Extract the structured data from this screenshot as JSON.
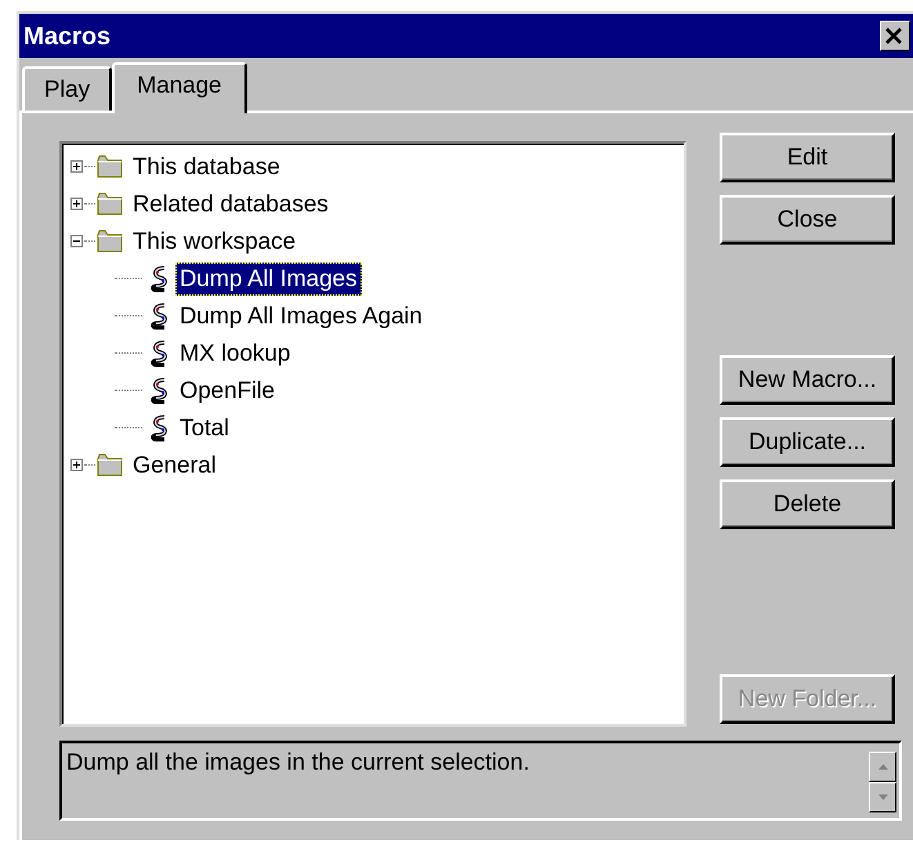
{
  "window": {
    "title": "Macros"
  },
  "tabs": [
    {
      "label": "Play",
      "selected": false
    },
    {
      "label": "Manage",
      "selected": true
    }
  ],
  "tree": [
    {
      "kind": "folder",
      "label": "This database",
      "expanded": false,
      "selected": false
    },
    {
      "kind": "folder",
      "label": "Related databases",
      "expanded": false,
      "selected": false
    },
    {
      "kind": "folder",
      "label": "This workspace",
      "expanded": true,
      "selected": false,
      "children": [
        {
          "kind": "macro",
          "label": "Dump All Images",
          "selected": true
        },
        {
          "kind": "macro",
          "label": "Dump All Images Again",
          "selected": false
        },
        {
          "kind": "macro",
          "label": "MX lookup",
          "selected": false
        },
        {
          "kind": "macro",
          "label": "OpenFile",
          "selected": false
        },
        {
          "kind": "macro",
          "label": "Total",
          "selected": false
        }
      ]
    },
    {
      "kind": "folder",
      "label": "General",
      "expanded": false,
      "selected": false
    }
  ],
  "button_groups": [
    [
      {
        "label": "Edit",
        "disabled": false
      },
      {
        "label": "Close",
        "disabled": false
      }
    ],
    [
      {
        "label": "New Macro...",
        "disabled": false
      },
      {
        "label": "Duplicate...",
        "disabled": false
      },
      {
        "label": "Delete",
        "disabled": false
      }
    ],
    [
      {
        "label": "New Folder...",
        "disabled": true
      }
    ]
  ],
  "description": "Dump all the images in the current selection."
}
